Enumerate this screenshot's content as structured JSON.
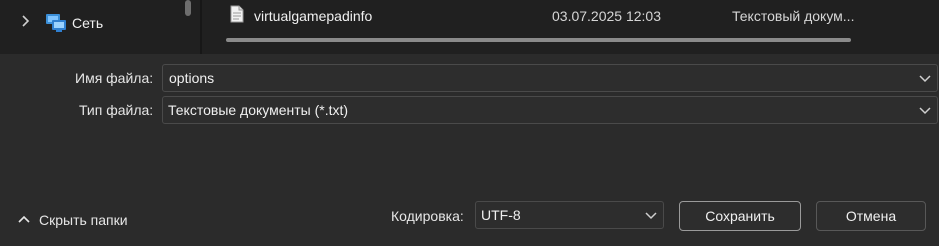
{
  "nav": {
    "network_label": "Сеть",
    "network_icon": "network-icon",
    "expand_icon": "chevron-right-icon"
  },
  "files": {
    "rows": [
      {
        "name": "virtualgamepadinfo",
        "date": "03.07.2025 12:03",
        "type": "Текстовый докум...",
        "icon": "text-document-icon"
      }
    ]
  },
  "form": {
    "filename_label": "Имя файла:",
    "filename_value": "options",
    "filetype_label": "Тип файла:",
    "filetype_value": "Текстовые документы (*.txt)"
  },
  "footer": {
    "hide_folders_label": "Скрыть папки",
    "encoding_label": "Кодировка:",
    "encoding_value": "UTF-8",
    "save_label": "Сохранить",
    "cancel_label": "Отмена"
  },
  "colors": {
    "background": "#2b2b2b",
    "pane": "#202020",
    "field": "#2d2d2d",
    "text": "#e6e6e6"
  }
}
